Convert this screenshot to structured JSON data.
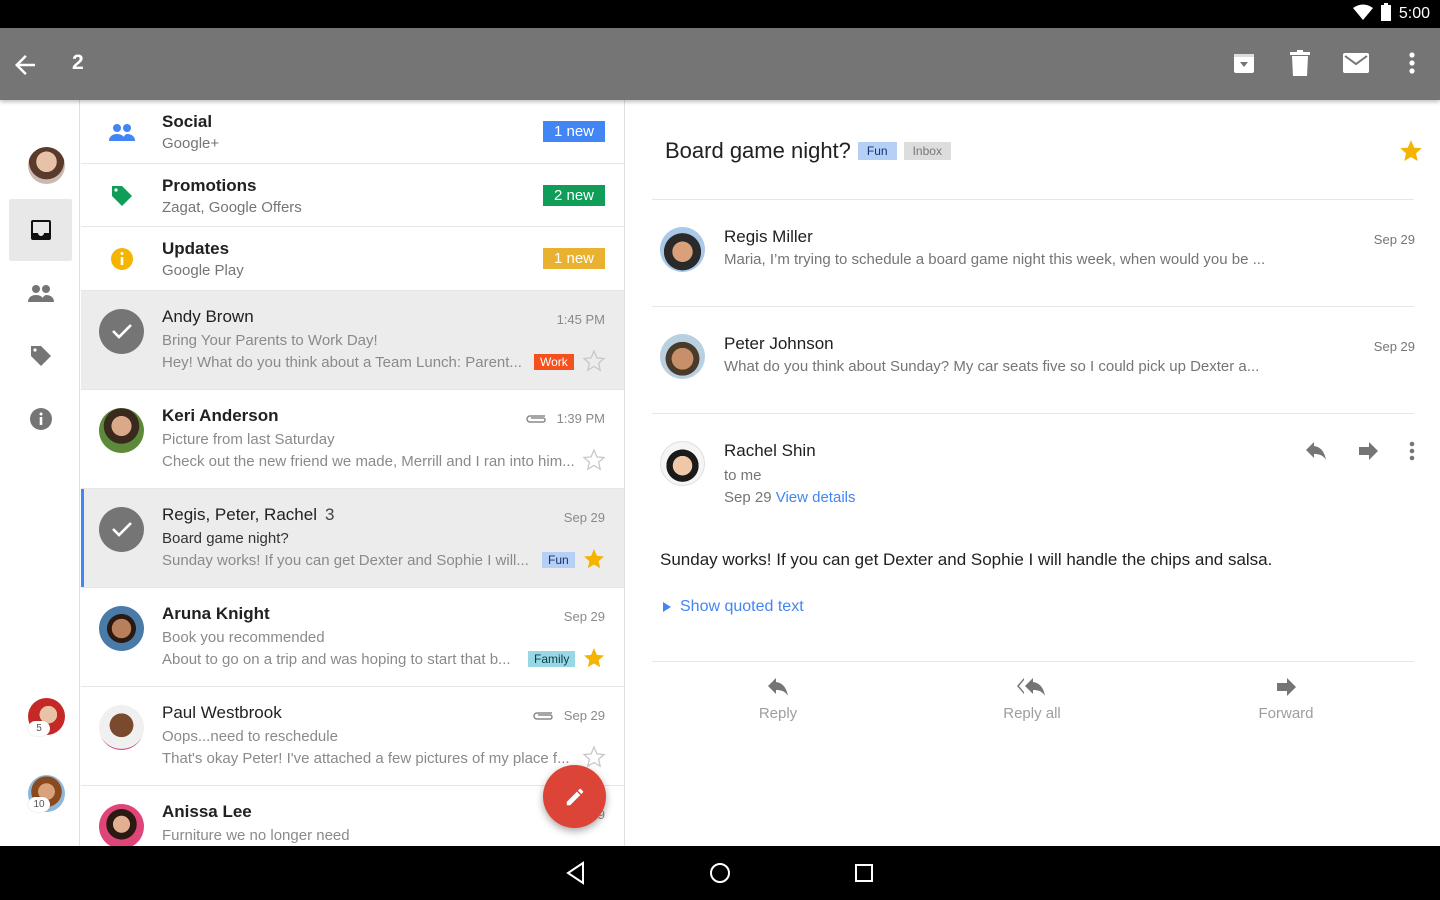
{
  "status_bar": {
    "time": "5:00",
    "icons": [
      "wifi-icon",
      "battery-icon"
    ]
  },
  "app_bar": {
    "selected_count": "2",
    "icons": [
      "back-arrow-icon",
      "archive-icon",
      "delete-icon",
      "mark-unread-icon",
      "more-vert-icon"
    ]
  },
  "rail": {
    "account_badges": [
      "5",
      "10"
    ],
    "items": [
      "inbox",
      "people",
      "labels",
      "info"
    ]
  },
  "categories": [
    {
      "title": "Social",
      "sub": "Google+",
      "badge": "1 new",
      "color": "#4285f4",
      "icon": "people-icon"
    },
    {
      "title": "Promotions",
      "sub": "Zagat, Google Offers",
      "badge": "2 new",
      "color": "#0f9d58",
      "icon": "tag-icon"
    },
    {
      "title": "Updates",
      "sub": "Google Play",
      "badge": "1 new",
      "color": "#f4b400",
      "icon": "info-icon"
    }
  ],
  "threads": [
    {
      "sender": "Andy Brown",
      "count": "",
      "date": "1:45 PM",
      "subject": "Bring Your Parents to Work Day!",
      "snippet": "Hey! What do you think about a Team Lunch: Parent...",
      "label": "Work",
      "label_bg": "#f4511e",
      "label_fg": "#ffffff",
      "starred": false,
      "selected": true,
      "unread": false,
      "attachment": false
    },
    {
      "sender": "Keri Anderson",
      "count": "",
      "date": "1:39 PM",
      "subject": "Picture from last Saturday",
      "snippet": "Check out the new friend we made, Merrill and I ran into him...",
      "label": "",
      "starred": false,
      "selected": false,
      "unread": true,
      "attachment": true
    },
    {
      "sender": "Regis, Peter, Rachel",
      "count": "3",
      "date": "Sep 29",
      "subject": "Board game night?",
      "snippet": "Sunday works! If you can get Dexter and Sophie I will...",
      "label": "Fun",
      "label_bg": "#b6cff5",
      "label_fg": "#0d3472",
      "starred": true,
      "selected": true,
      "unread": false,
      "attachment": false
    },
    {
      "sender": "Aruna Knight",
      "count": "",
      "date": "Sep 29",
      "subject": "Book you recommended",
      "snippet": "About to go on a trip and was hoping to start that b...",
      "label": "Family",
      "label_bg": "#98d7e4",
      "label_fg": "#0d3b44",
      "starred": true,
      "selected": false,
      "unread": true,
      "attachment": false
    },
    {
      "sender": "Paul Westbrook",
      "count": "",
      "date": "Sep 29",
      "subject": "Oops...need to reschedule",
      "snippet": "That's okay Peter! I've attached a few pictures of my place f...",
      "label": "",
      "starred": false,
      "selected": false,
      "unread": false,
      "attachment": true
    },
    {
      "sender": "Anissa Lee",
      "count": "",
      "date": "Sep 29",
      "subject": "Furniture we no longer need",
      "snippet": "",
      "label": "",
      "starred": false,
      "selected": false,
      "unread": true,
      "attachment": false
    }
  ],
  "detail": {
    "subject": "Board game night?",
    "labels": [
      {
        "text": "Fun",
        "bg": "#b6cff5",
        "fg": "#0d3472"
      },
      {
        "text": "Inbox",
        "bg": "#dddddd",
        "fg": "#777777"
      }
    ],
    "starred": true,
    "messages": [
      {
        "name": "Regis Miller",
        "snippet": "Maria, I’m trying to schedule a board game night this week, when would you be ...",
        "date": "Sep 29"
      },
      {
        "name": "Peter Johnson",
        "snippet": "What do you think about Sunday? My car seats five so I could pick up Dexter a...",
        "date": "Sep 29"
      }
    ],
    "open_message": {
      "name": "Rachel Shin",
      "to": "to me",
      "date": "Sep 29",
      "view_details": "View details",
      "body": "Sunday works! If you can get Dexter and Sophie I will handle the chips and salsa.",
      "show_quoted": "Show quoted text"
    },
    "actions": {
      "reply": "Reply",
      "reply_all": "Reply all",
      "forward": "Forward"
    }
  },
  "nav_bar": {
    "icons": [
      "back-icon",
      "home-icon",
      "recents-icon"
    ]
  }
}
